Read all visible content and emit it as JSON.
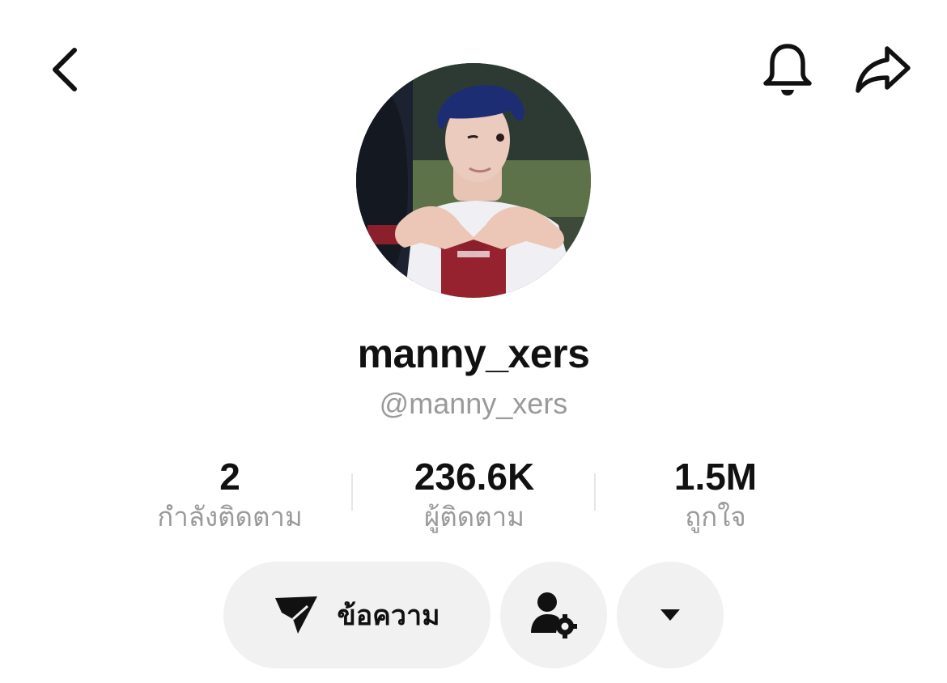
{
  "profile": {
    "display_name": "manny_xers",
    "handle": "@manny_xers"
  },
  "stats": [
    {
      "value": "2",
      "label": "กำลังติดตาม"
    },
    {
      "value": "236.6K",
      "label": "ผู้ติดตาม"
    },
    {
      "value": "1.5M",
      "label": "ถูกใจ"
    }
  ],
  "actions": {
    "message_label": "ข้อความ"
  },
  "icons": {
    "back": "chevron-left-icon",
    "notification": "bell-icon",
    "share": "share-arrow-icon",
    "message": "send-icon",
    "friend_settings": "person-gear-icon",
    "more": "caret-down-icon"
  }
}
